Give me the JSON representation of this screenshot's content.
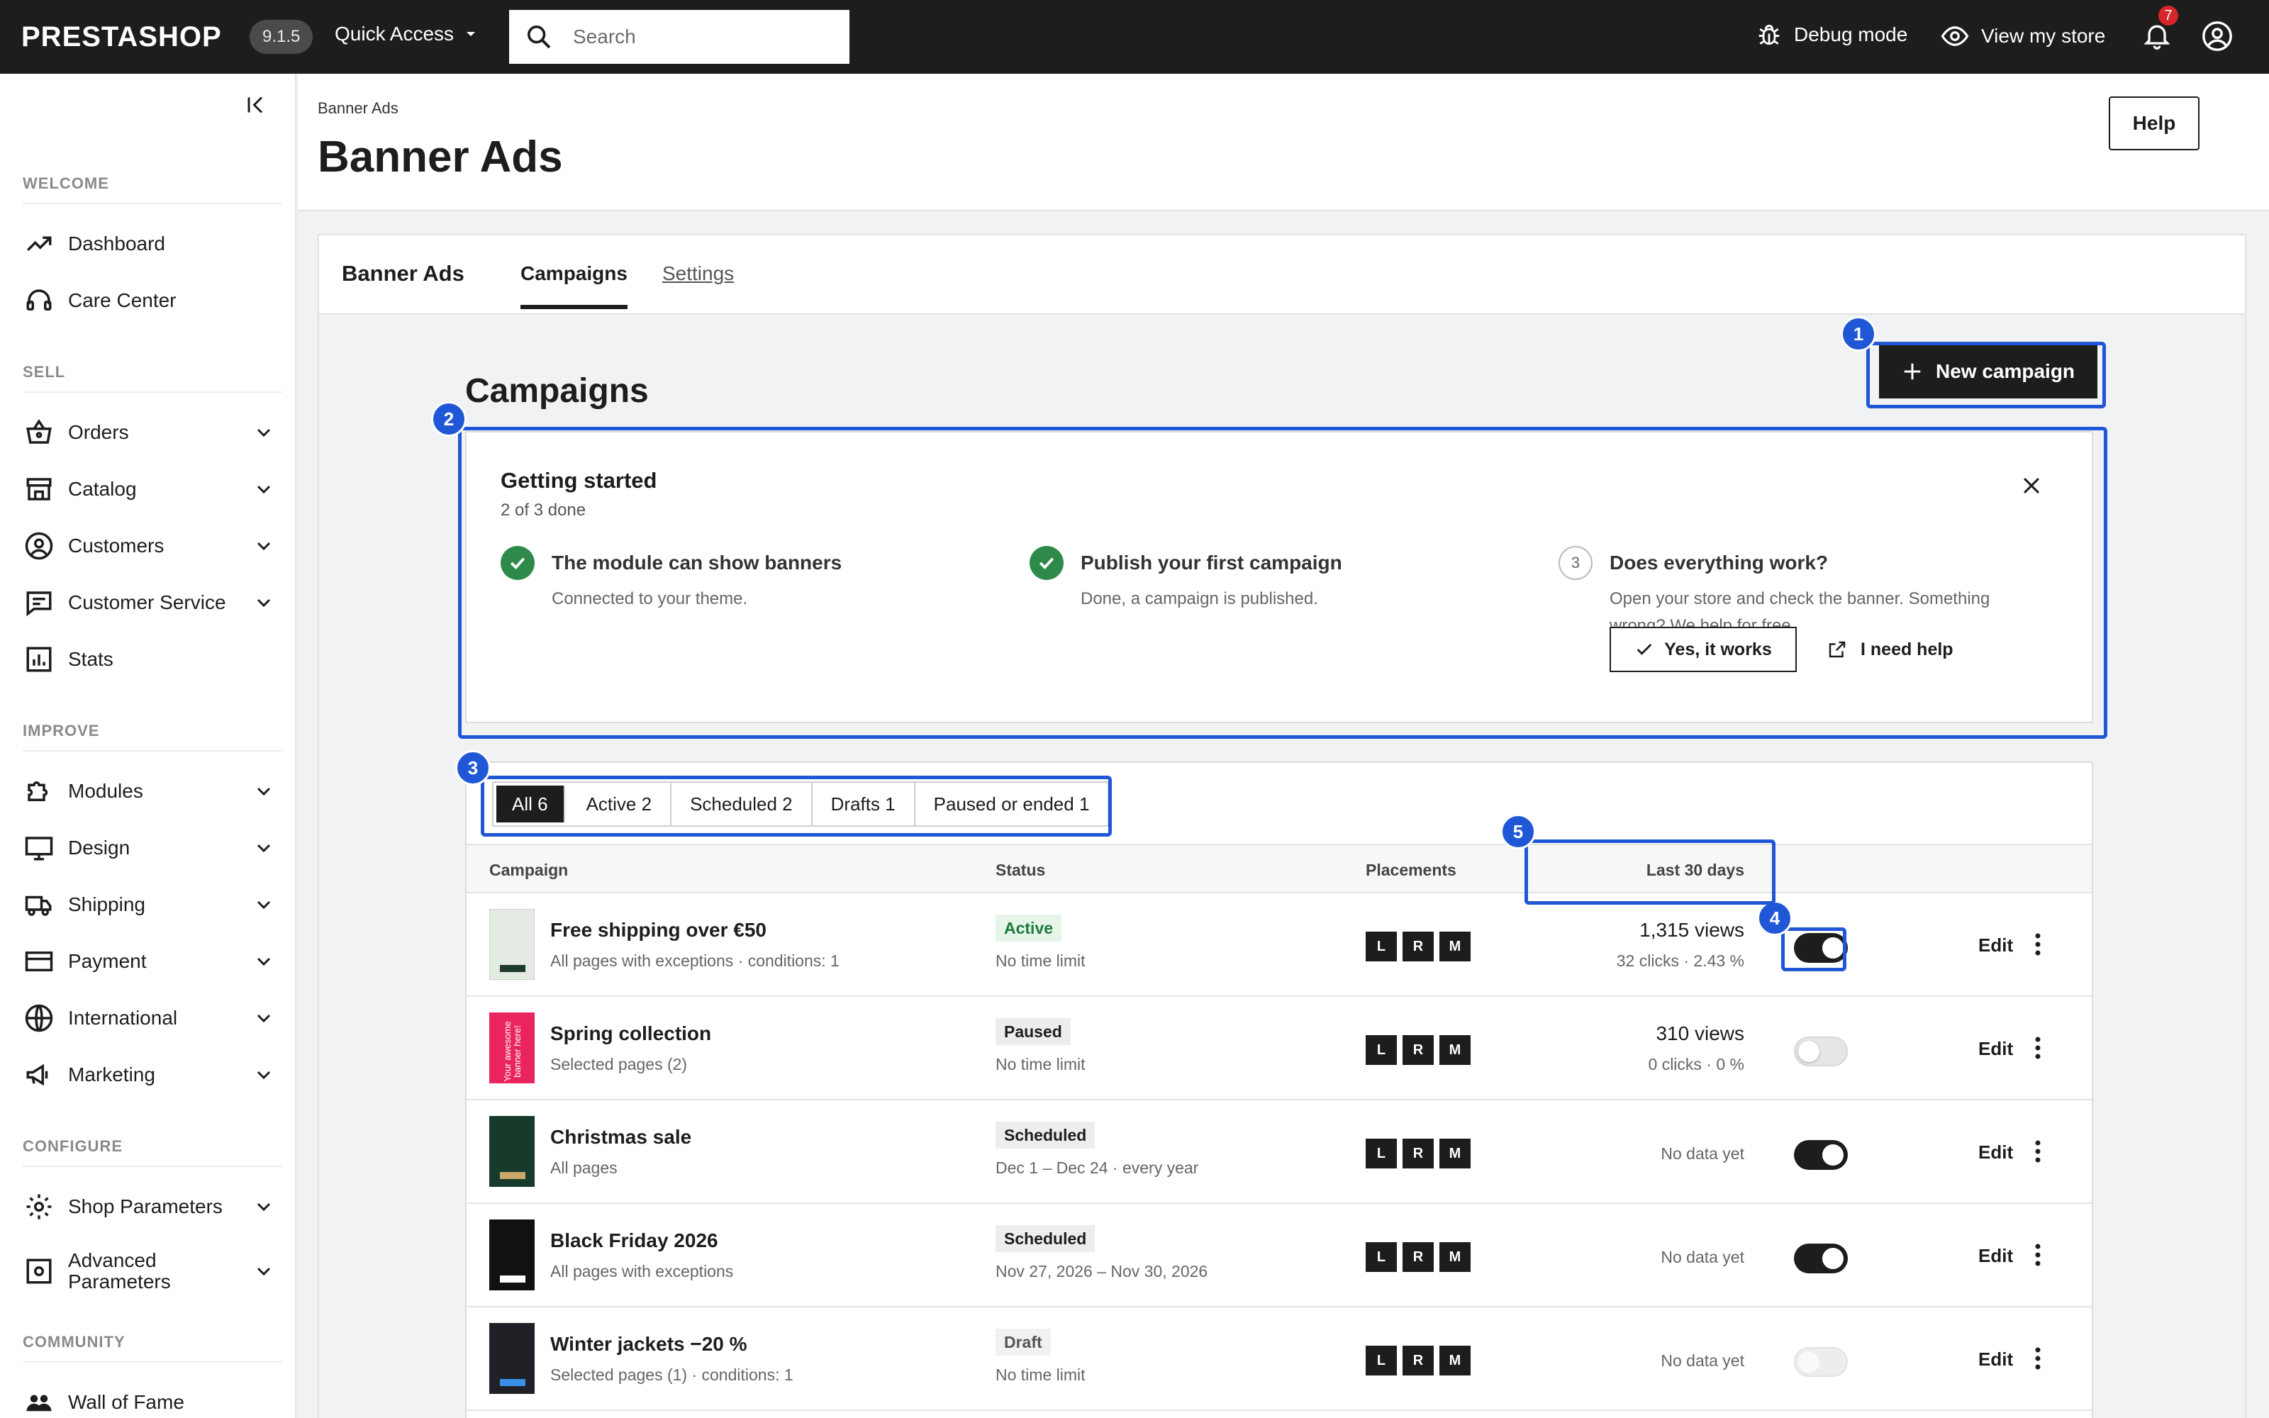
{
  "topbar": {
    "logo": "PRESTASHOP",
    "version": "9.1.5",
    "quick_access": "Quick Access",
    "search_placeholder": "Search",
    "debug": "Debug mode",
    "view_store": "View my store",
    "notif_count": "7"
  },
  "sidebar": {
    "sections": {
      "welcome": "WELCOME",
      "sell": "SELL",
      "improve": "IMPROVE",
      "configure": "CONFIGURE",
      "community": "COMMUNITY"
    },
    "items": [
      "Dashboard",
      "Care Center",
      "Orders",
      "Catalog",
      "Customers",
      "Customer Service",
      "Stats",
      "Modules",
      "Design",
      "Shipping",
      "Payment",
      "International",
      "Marketing",
      "Shop Parameters",
      "Advanced Parameters",
      "Wall of Fame"
    ]
  },
  "header": {
    "breadcrumb": "Banner Ads",
    "title": "Banner Ads",
    "help": "Help"
  },
  "tabs": {
    "module": "Banner Ads",
    "campaigns": "Campaigns",
    "settings": "Settings"
  },
  "main": {
    "title": "Campaigns",
    "new_campaign": "New campaign"
  },
  "getting_started": {
    "title": "Getting started",
    "progress": "2 of 3 done",
    "steps": [
      {
        "title": "The module can show banners",
        "desc": "Connected to your theme."
      },
      {
        "title": "Publish your first campaign",
        "desc": "Done, a campaign is published."
      },
      {
        "num": "3",
        "title": "Does everything work?",
        "desc": "Open your store and check the banner. Something wrong? We help for free."
      }
    ],
    "yes": "Yes, it works",
    "need_help": "I need help"
  },
  "filters": [
    "All 6",
    "Active 2",
    "Scheduled 2",
    "Drafts 1",
    "Paused or ended 1"
  ],
  "table": {
    "headers": {
      "campaign": "Campaign",
      "status": "Status",
      "placements": "Placements",
      "last30": "Last 30 days"
    },
    "rows": [
      {
        "name": "Free shipping over €50",
        "desc": "All pages with exceptions · conditions: 1",
        "status": "Active",
        "sdesc": "No time limit",
        "p": [
          "L",
          "R",
          "M"
        ],
        "views": "1,315 views",
        "clicks": "32 clicks · 2.43 %",
        "toggle": "on",
        "edit": "Edit"
      },
      {
        "name": "Spring collection",
        "desc": "Selected pages (2)",
        "status": "Paused",
        "sdesc": "No time limit",
        "p": [
          "L",
          "R",
          "M"
        ],
        "views": "310 views",
        "clicks": "0 clicks · 0 %",
        "toggle": "off",
        "edit": "Edit",
        "thumb_text": "Your awesome banner here!"
      },
      {
        "name": "Christmas sale",
        "desc": "All pages",
        "status": "Scheduled",
        "sdesc": "Dec 1 – Dec 24 · every year",
        "p": [
          "L",
          "R",
          "M"
        ],
        "nodata": "No data yet",
        "toggle": "on",
        "edit": "Edit"
      },
      {
        "name": "Black Friday 2026",
        "desc": "All pages with exceptions",
        "status": "Scheduled",
        "sdesc": "Nov 27, 2026 – Nov 30, 2026",
        "p": [
          "L",
          "R",
          "M"
        ],
        "nodata": "No data yet",
        "toggle": "on",
        "edit": "Edit"
      },
      {
        "name": "Winter jackets −20 %",
        "desc": "Selected pages (1) · conditions: 1",
        "status": "Draft",
        "sdesc": "No time limit",
        "p": [
          "L",
          "R",
          "M"
        ],
        "nodata": "No data yet",
        "toggle": "disabled",
        "edit": "Edit"
      }
    ]
  },
  "annotations": [
    "1",
    "2",
    "3",
    "4",
    "5"
  ],
  "colors": {
    "brand_dark": "#1d1d1b",
    "annotation": "#1f57d6",
    "success": "#2e8a4a",
    "active_badge_bg": "#e6f4ea",
    "active_badge_text": "#1e7a3c",
    "notif": "#d7262b"
  }
}
